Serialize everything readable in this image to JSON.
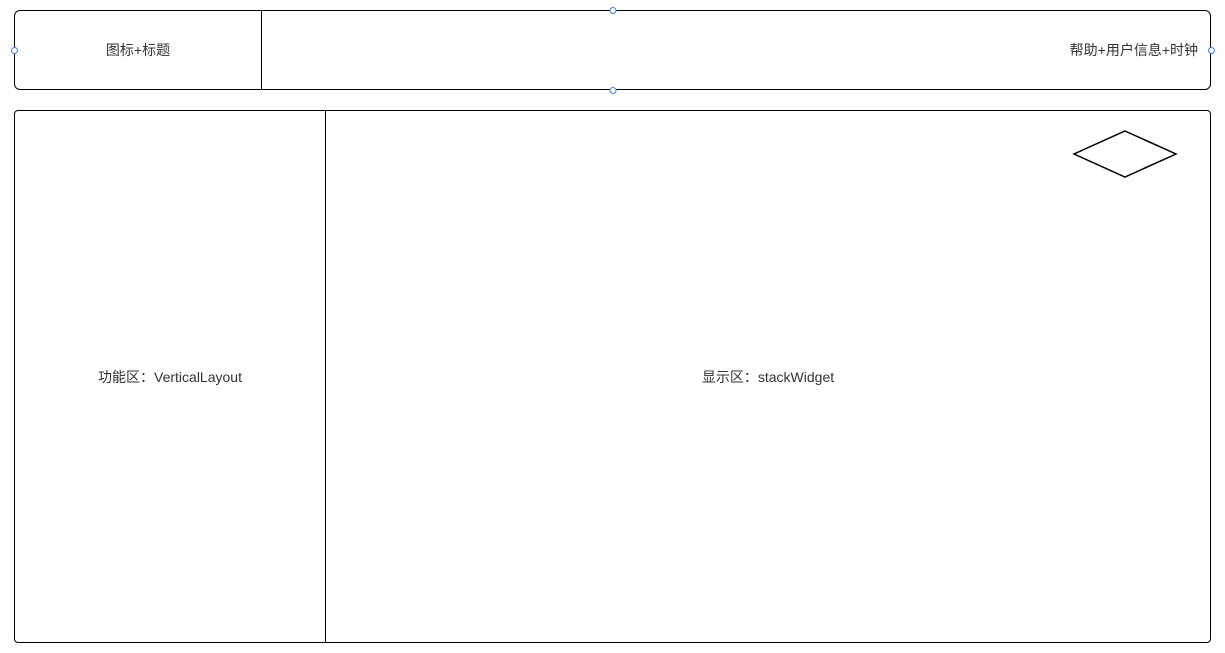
{
  "header": {
    "left_label": "图标+标题",
    "right_label": "帮助+用户信息+时钟"
  },
  "body": {
    "sidebar_label": "功能区：VerticalLayout",
    "main_label": "显示区：stackWidget"
  }
}
